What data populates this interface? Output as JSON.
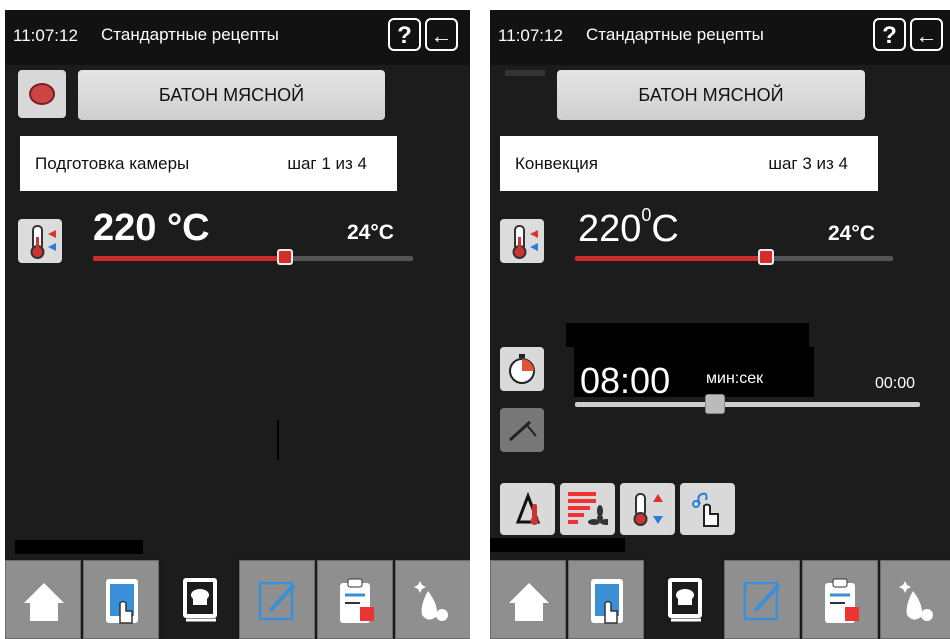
{
  "left": {
    "time": "11:07:12",
    "title": "Стандартные рецепты",
    "help_icon": "?",
    "back_icon": "←",
    "recipe_name": "БАТОН МЯСНОЙ",
    "step_label": "Подготовка камеры",
    "step_progress": "шаг 1 из 4",
    "target_temp": "220 °C",
    "current_temp": "24°C",
    "temp_slider_fraction": 0.6
  },
  "right": {
    "time": "11:07:12",
    "title": "Стандартные рецепты",
    "help_icon": "?",
    "back_icon": "←",
    "recipe_name": "БАТОН МЯСНОЙ",
    "step_label": "Конвекция",
    "step_progress": "шаг 3 из 4",
    "target_temp_value": "220",
    "target_temp_degree": "0",
    "target_temp_unit": "C",
    "current_temp": "24°C",
    "temp_slider_fraction": 0.6,
    "timer_value": "08:00",
    "timer_unit": "мин:сек",
    "timer_max": "00:00"
  },
  "tabs": [
    {
      "icon": "home-icon",
      "active": false
    },
    {
      "icon": "tablet-touch-icon",
      "active": false
    },
    {
      "icon": "cookbook-icon",
      "active": true
    },
    {
      "icon": "edit-icon",
      "active": false
    },
    {
      "icon": "clipboard-icon",
      "active": false
    },
    {
      "icon": "cleaning-icon",
      "active": false
    }
  ],
  "colors": {
    "panel_bg": "#1c1c1c",
    "accent_red": "#cc2b2b",
    "button_gray": "#d9d9d9",
    "tab_gray": "#8f8f8f"
  }
}
